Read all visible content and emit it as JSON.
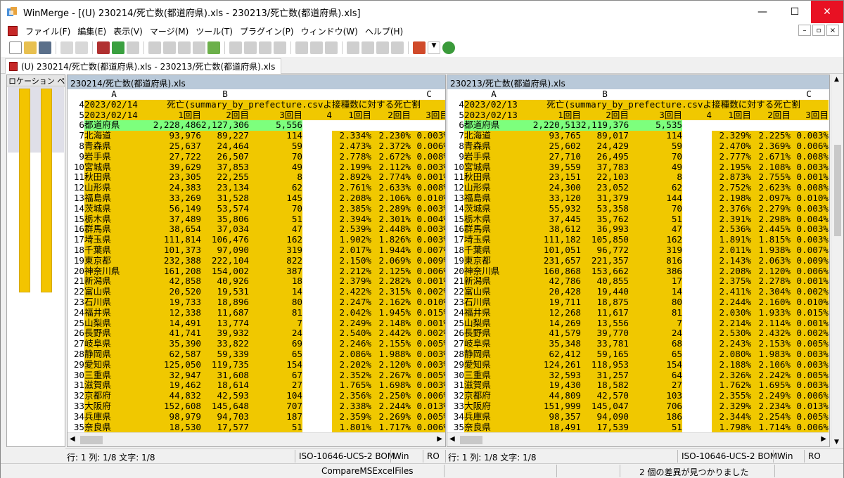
{
  "window": {
    "title": "WinMerge - [(U) 230214/死亡数(都道府県).xls - 230213/死亡数(都道府県).xls]",
    "minimize": "—",
    "maximize": "☐",
    "close": "✕"
  },
  "menu": [
    "ファイル(F)",
    "編集(E)",
    "表示(V)",
    "マージ(M)",
    "ツール(T)",
    "プラグイン(P)",
    "ウィンドウ(W)",
    "ヘルプ(H)"
  ],
  "mdi": [
    "–",
    "▫",
    "×"
  ],
  "tab": {
    "label": "(U) 230214/死亡数(都道府県).xls - 230213/死亡数(都道府県).xls"
  },
  "location_pane": {
    "header": "ロケーション ペ"
  },
  "left": {
    "header": "230214/死亡数(都道府県).xls",
    "col_headers": [
      "A",
      "B",
      "C"
    ],
    "r4": {
      "num": "4",
      "a": "2023/02/14",
      "b": "死亡(summary_by_prefecture.csvよ",
      "c": "接種数に対する死亡割"
    },
    "r5": {
      "num": "5",
      "a": "2023/02/14",
      "b1": "1回目",
      "b2": "2回目",
      "b3": "3回目",
      "b4": "4",
      "c1": "1回目",
      "c2": "2回目",
      "c3": "3回目"
    },
    "rows": [
      {
        "n": "6",
        "p": "都道府県",
        "v1": "2,228,486",
        "v2": "2,127,306",
        "v3": "5,556",
        "c1": "",
        "c2": "",
        "c3": ""
      },
      {
        "n": "7",
        "p": "北海道",
        "v1": "93,976",
        "v2": "89,227",
        "v3": "114",
        "c1": "2.334%",
        "c2": "2.230%",
        "c3": "0.003%"
      },
      {
        "n": "8",
        "p": "青森県",
        "v1": "25,637",
        "v2": "24,464",
        "v3": "59",
        "c1": "2.473%",
        "c2": "2.372%",
        "c3": "0.006%"
      },
      {
        "n": "9",
        "p": "岩手県",
        "v1": "27,722",
        "v2": "26,507",
        "v3": "70",
        "c1": "2.778%",
        "c2": "2.672%",
        "c3": "0.008%"
      },
      {
        "n": "10",
        "p": "宮城県",
        "v1": "39,629",
        "v2": "37,853",
        "v3": "49",
        "c1": "2.199%",
        "c2": "2.112%",
        "c3": "0.003%"
      },
      {
        "n": "11",
        "p": "秋田県",
        "v1": "23,305",
        "v2": "22,255",
        "v3": "8",
        "c1": "2.892%",
        "c2": "2.774%",
        "c3": "0.001%"
      },
      {
        "n": "12",
        "p": "山形県",
        "v1": "24,383",
        "v2": "23,134",
        "v3": "62",
        "c1": "2.761%",
        "c2": "2.633%",
        "c3": "0.008%"
      },
      {
        "n": "13",
        "p": "福島県",
        "v1": "33,269",
        "v2": "31,528",
        "v3": "145",
        "c1": "2.208%",
        "c2": "2.106%",
        "c3": "0.010%"
      },
      {
        "n": "14",
        "p": "茨城県",
        "v1": "56,149",
        "v2": "53,574",
        "v3": "70",
        "c1": "2.385%",
        "c2": "2.289%",
        "c3": "0.003%"
      },
      {
        "n": "15",
        "p": "栃木県",
        "v1": "37,489",
        "v2": "35,806",
        "v3": "51",
        "c1": "2.394%",
        "c2": "2.301%",
        "c3": "0.004%"
      },
      {
        "n": "16",
        "p": "群馬県",
        "v1": "38,654",
        "v2": "37,034",
        "v3": "47",
        "c1": "2.539%",
        "c2": "2.448%",
        "c3": "0.003%"
      },
      {
        "n": "17",
        "p": "埼玉県",
        "v1": "111,814",
        "v2": "106,476",
        "v3": "162",
        "c1": "1.902%",
        "c2": "1.826%",
        "c3": "0.003%"
      },
      {
        "n": "18",
        "p": "千葉県",
        "v1": "101,373",
        "v2": "97,090",
        "v3": "319",
        "c1": "2.017%",
        "c2": "1.944%",
        "c3": "0.007%"
      },
      {
        "n": "19",
        "p": "東京都",
        "v1": "232,388",
        "v2": "222,104",
        "v3": "822",
        "c1": "2.150%",
        "c2": "2.069%",
        "c3": "0.009%"
      },
      {
        "n": "20",
        "p": "神奈川県",
        "v1": "161,208",
        "v2": "154,002",
        "v3": "387",
        "c1": "2.212%",
        "c2": "2.125%",
        "c3": "0.006%"
      },
      {
        "n": "21",
        "p": "新潟県",
        "v1": "42,858",
        "v2": "40,926",
        "v3": "18",
        "c1": "2.379%",
        "c2": "2.282%",
        "c3": "0.001%"
      },
      {
        "n": "22",
        "p": "富山県",
        "v1": "20,520",
        "v2": "19,531",
        "v3": "14",
        "c1": "2.422%",
        "c2": "2.315%",
        "c3": "0.002%"
      },
      {
        "n": "23",
        "p": "石川県",
        "v1": "19,733",
        "v2": "18,896",
        "v3": "80",
        "c1": "2.247%",
        "c2": "2.162%",
        "c3": "0.010%"
      },
      {
        "n": "24",
        "p": "福井県",
        "v1": "12,338",
        "v2": "11,687",
        "v3": "81",
        "c1": "2.042%",
        "c2": "1.945%",
        "c3": "0.015%"
      },
      {
        "n": "25",
        "p": "山梨県",
        "v1": "14,491",
        "v2": "13,774",
        "v3": "7",
        "c1": "2.249%",
        "c2": "2.148%",
        "c3": "0.001%"
      },
      {
        "n": "26",
        "p": "長野県",
        "v1": "41,741",
        "v2": "39,932",
        "v3": "24",
        "c1": "2.540%",
        "c2": "2.442%",
        "c3": "0.002%"
      },
      {
        "n": "27",
        "p": "岐阜県",
        "v1": "35,390",
        "v2": "33,822",
        "v3": "69",
        "c1": "2.246%",
        "c2": "2.155%",
        "c3": "0.005%"
      },
      {
        "n": "28",
        "p": "静岡県",
        "v1": "62,587",
        "v2": "59,339",
        "v3": "65",
        "c1": "2.086%",
        "c2": "1.988%",
        "c3": "0.003%"
      },
      {
        "n": "29",
        "p": "愛知県",
        "v1": "125,050",
        "v2": "119,735",
        "v3": "154",
        "c1": "2.202%",
        "c2": "2.120%",
        "c3": "0.003%"
      },
      {
        "n": "30",
        "p": "三重県",
        "v1": "32,947",
        "v2": "31,608",
        "v3": "67",
        "c1": "2.352%",
        "c2": "2.267%",
        "c3": "0.005%"
      },
      {
        "n": "31",
        "p": "滋賀県",
        "v1": "19,462",
        "v2": "18,614",
        "v3": "27",
        "c1": "1.765%",
        "c2": "1.698%",
        "c3": "0.003%"
      },
      {
        "n": "32",
        "p": "京都府",
        "v1": "44,832",
        "v2": "42,593",
        "v3": "104",
        "c1": "2.356%",
        "c2": "2.250%",
        "c3": "0.006%"
      },
      {
        "n": "33",
        "p": "大阪府",
        "v1": "152,608",
        "v2": "145,648",
        "v3": "707",
        "c1": "2.338%",
        "c2": "2.244%",
        "c3": "0.013%"
      },
      {
        "n": "34",
        "p": "兵庫県",
        "v1": "98,979",
        "v2": "94,703",
        "v3": "187",
        "c1": "2.359%",
        "c2": "2.269%",
        "c3": "0.005%"
      },
      {
        "n": "35",
        "p": "奈良県",
        "v1": "18,530",
        "v2": "17,577",
        "v3": "51",
        "c1": "1.801%",
        "c2": "1.717%",
        "c3": "0.006%"
      }
    ]
  },
  "right": {
    "header": "230213/死亡数(都道府県).xls",
    "col_headers": [
      "A",
      "B",
      "C"
    ],
    "r4": {
      "num": "4",
      "a": "2023/02/13",
      "b": "死亡(summary_by_prefecture.csvよ",
      "c": "接種数に対する死亡割"
    },
    "r5": {
      "num": "5",
      "a": "2023/02/13",
      "b1": "1回目",
      "b2": "2回目",
      "b3": "3回目",
      "b4": "4",
      "c1": "1回目",
      "c2": "2回目",
      "c3": "3回目"
    },
    "rows": [
      {
        "n": "6",
        "p": "都道府県",
        "v1": "2,220,513",
        "v2": "2,119,376",
        "v3": "5,535",
        "c1": "",
        "c2": "",
        "c3": ""
      },
      {
        "n": "7",
        "p": "北海道",
        "v1": "93,765",
        "v2": "89,017",
        "v3": "114",
        "c1": "2.329%",
        "c2": "2.225%",
        "c3": "0.003%"
      },
      {
        "n": "8",
        "p": "青森県",
        "v1": "25,602",
        "v2": "24,429",
        "v3": "59",
        "c1": "2.470%",
        "c2": "2.369%",
        "c3": "0.006%"
      },
      {
        "n": "9",
        "p": "岩手県",
        "v1": "27,710",
        "v2": "26,495",
        "v3": "70",
        "c1": "2.777%",
        "c2": "2.671%",
        "c3": "0.008%"
      },
      {
        "n": "10",
        "p": "宮城県",
        "v1": "39,559",
        "v2": "37,783",
        "v3": "49",
        "c1": "2.195%",
        "c2": "2.108%",
        "c3": "0.003%"
      },
      {
        "n": "11",
        "p": "秋田県",
        "v1": "23,151",
        "v2": "22,103",
        "v3": "8",
        "c1": "2.873%",
        "c2": "2.755%",
        "c3": "0.001%"
      },
      {
        "n": "12",
        "p": "山形県",
        "v1": "24,300",
        "v2": "23,052",
        "v3": "62",
        "c1": "2.752%",
        "c2": "2.623%",
        "c3": "0.008%"
      },
      {
        "n": "13",
        "p": "福島県",
        "v1": "33,120",
        "v2": "31,379",
        "v3": "144",
        "c1": "2.198%",
        "c2": "2.097%",
        "c3": "0.010%"
      },
      {
        "n": "14",
        "p": "茨城県",
        "v1": "55,932",
        "v2": "53,358",
        "v3": "70",
        "c1": "2.376%",
        "c2": "2.279%",
        "c3": "0.003%"
      },
      {
        "n": "15",
        "p": "栃木県",
        "v1": "37,445",
        "v2": "35,762",
        "v3": "51",
        "c1": "2.391%",
        "c2": "2.298%",
        "c3": "0.004%"
      },
      {
        "n": "16",
        "p": "群馬県",
        "v1": "38,612",
        "v2": "36,993",
        "v3": "47",
        "c1": "2.536%",
        "c2": "2.445%",
        "c3": "0.003%"
      },
      {
        "n": "17",
        "p": "埼玉県",
        "v1": "111,182",
        "v2": "105,850",
        "v3": "162",
        "c1": "1.891%",
        "c2": "1.815%",
        "c3": "0.003%"
      },
      {
        "n": "18",
        "p": "千葉県",
        "v1": "101,051",
        "v2": "96,772",
        "v3": "319",
        "c1": "2.011%",
        "c2": "1.938%",
        "c3": "0.007%"
      },
      {
        "n": "19",
        "p": "東京都",
        "v1": "231,657",
        "v2": "221,357",
        "v3": "816",
        "c1": "2.143%",
        "c2": "2.063%",
        "c3": "0.009%"
      },
      {
        "n": "20",
        "p": "神奈川県",
        "v1": "160,868",
        "v2": "153,662",
        "v3": "386",
        "c1": "2.208%",
        "c2": "2.120%",
        "c3": "0.006%"
      },
      {
        "n": "21",
        "p": "新潟県",
        "v1": "42,786",
        "v2": "40,855",
        "v3": "17",
        "c1": "2.375%",
        "c2": "2.278%",
        "c3": "0.001%"
      },
      {
        "n": "22",
        "p": "富山県",
        "v1": "20,428",
        "v2": "19,440",
        "v3": "14",
        "c1": "2.411%",
        "c2": "2.304%",
        "c3": "0.002%"
      },
      {
        "n": "23",
        "p": "石川県",
        "v1": "19,711",
        "v2": "18,875",
        "v3": "80",
        "c1": "2.244%",
        "c2": "2.160%",
        "c3": "0.010%"
      },
      {
        "n": "24",
        "p": "福井県",
        "v1": "12,268",
        "v2": "11,617",
        "v3": "81",
        "c1": "2.030%",
        "c2": "1.933%",
        "c3": "0.015%"
      },
      {
        "n": "25",
        "p": "山梨県",
        "v1": "14,269",
        "v2": "13,556",
        "v3": "7",
        "c1": "2.214%",
        "c2": "2.114%",
        "c3": "0.001%"
      },
      {
        "n": "26",
        "p": "長野県",
        "v1": "41,579",
        "v2": "39,770",
        "v3": "24",
        "c1": "2.530%",
        "c2": "2.432%",
        "c3": "0.002%"
      },
      {
        "n": "27",
        "p": "岐阜県",
        "v1": "35,348",
        "v2": "33,781",
        "v3": "68",
        "c1": "2.243%",
        "c2": "2.153%",
        "c3": "0.005%"
      },
      {
        "n": "28",
        "p": "静岡県",
        "v1": "62,412",
        "v2": "59,165",
        "v3": "65",
        "c1": "2.080%",
        "c2": "1.983%",
        "c3": "0.003%"
      },
      {
        "n": "29",
        "p": "愛知県",
        "v1": "124,261",
        "v2": "118,953",
        "v3": "154",
        "c1": "2.188%",
        "c2": "2.106%",
        "c3": "0.003%"
      },
      {
        "n": "30",
        "p": "三重県",
        "v1": "32,593",
        "v2": "31,257",
        "v3": "64",
        "c1": "2.326%",
        "c2": "2.242%",
        "c3": "0.005%"
      },
      {
        "n": "31",
        "p": "滋賀県",
        "v1": "19,430",
        "v2": "18,582",
        "v3": "27",
        "c1": "1.762%",
        "c2": "1.695%",
        "c3": "0.003%"
      },
      {
        "n": "32",
        "p": "京都府",
        "v1": "44,809",
        "v2": "42,570",
        "v3": "103",
        "c1": "2.355%",
        "c2": "2.249%",
        "c3": "0.006%"
      },
      {
        "n": "33",
        "p": "大阪府",
        "v1": "151,999",
        "v2": "145,047",
        "v3": "706",
        "c1": "2.329%",
        "c2": "2.234%",
        "c3": "0.013%"
      },
      {
        "n": "34",
        "p": "兵庫県",
        "v1": "98,357",
        "v2": "94,090",
        "v3": "186",
        "c1": "2.344%",
        "c2": "2.254%",
        "c3": "0.005%"
      },
      {
        "n": "35",
        "p": "奈良県",
        "v1": "18,491",
        "v2": "17,539",
        "v3": "51",
        "c1": "1.798%",
        "c2": "1.714%",
        "c3": "0.006%"
      }
    ]
  },
  "status_pane": {
    "left_pos": "行: 1  列: 1/8  文字: 1/8",
    "left_enc": "ISO-10646-UCS-2 BOM",
    "left_eol": "Win",
    "left_ro": "RO",
    "right_pos": "行: 1  列: 1/8  文字: 1/8",
    "right_enc": "ISO-10646-UCS-2 BOM",
    "right_eol": "Win",
    "right_ro": "RO"
  },
  "status_bar": {
    "plugin": "CompareMSExcelFiles",
    "diffs": "2 個の差異が見つかりました"
  },
  "colors": {
    "diff_yellow": "#f0c800",
    "selected_green": "#7dff7d",
    "pane_header": "#b9c9d9"
  }
}
